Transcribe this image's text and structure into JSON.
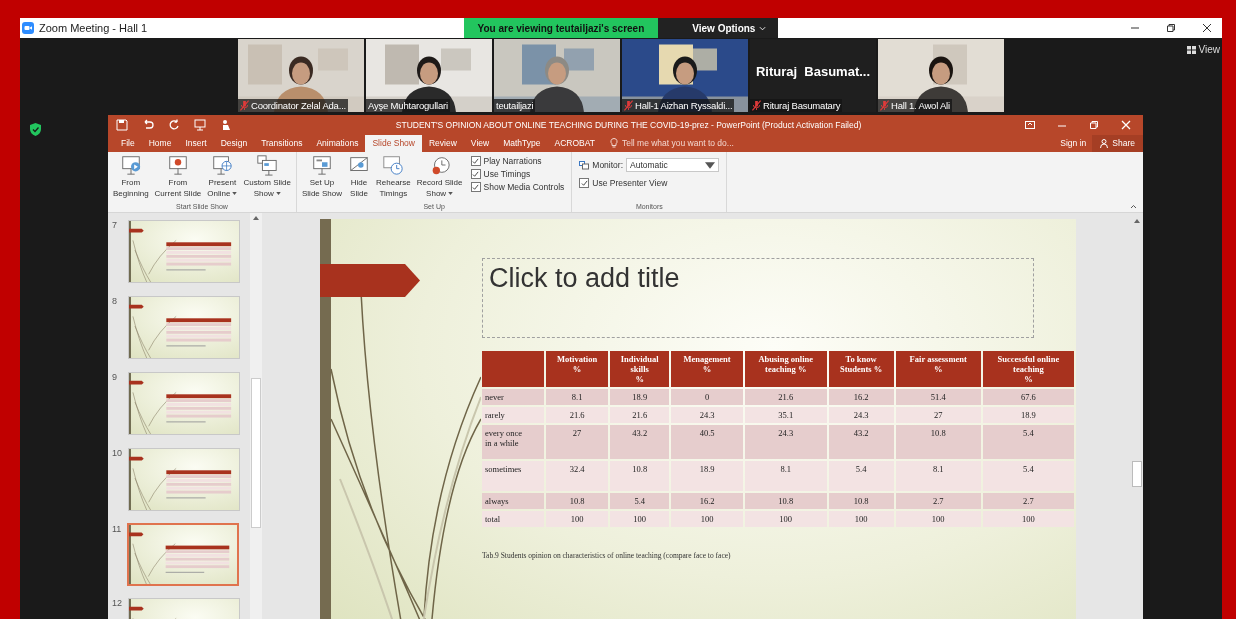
{
  "zoom": {
    "title": "Zoom Meeting - Hall 1",
    "banner": "You are viewing teutailjazi's screen",
    "view_options": "View Options",
    "view": "View"
  },
  "participants": [
    {
      "kind": "video",
      "name": "Coordinator Zelal Ada...",
      "muted": true
    },
    {
      "kind": "video",
      "name": "Ayşe Muhtarogullari",
      "muted": false
    },
    {
      "kind": "video",
      "name": "teutailjazi",
      "muted": false
    },
    {
      "kind": "video",
      "name": "Hall-1 Aizhan Ryssaldi...",
      "muted": true
    },
    {
      "kind": "avatar",
      "display_name": "Rituraj  Basumat...",
      "name": "Rituraj Basumatary",
      "muted": true
    },
    {
      "kind": "video",
      "name": "Hall 1. Awol Ali",
      "muted": true
    }
  ],
  "powerpoint": {
    "title": "STUDENT'S OPINION ABOUT ONLINE TEACHING DURING THE COVID-19-prez - PowerPoint (Product Activation Failed)",
    "tabs": [
      {
        "label": "File",
        "selected": false
      },
      {
        "label": "Home",
        "selected": false
      },
      {
        "label": "Insert",
        "selected": false
      },
      {
        "label": "Design",
        "selected": false
      },
      {
        "label": "Transitions",
        "selected": false
      },
      {
        "label": "Animations",
        "selected": false
      },
      {
        "label": "Slide Show",
        "selected": true
      },
      {
        "label": "Review",
        "selected": false
      },
      {
        "label": "View",
        "selected": false
      },
      {
        "label": "MathType",
        "selected": false
      },
      {
        "label": "ACROBAT",
        "selected": false
      }
    ],
    "tell_me": "Tell me what you want to do...",
    "sign_in": "Sign in",
    "share": "Share",
    "ribbon": [
      {
        "label": "Start Slide Show",
        "buttons": [
          {
            "lines": [
              "From",
              "Beginning"
            ],
            "menu": false
          },
          {
            "lines": [
              "From",
              "Current Slide"
            ],
            "menu": false
          },
          {
            "lines": [
              "Present",
              "Online"
            ],
            "menu": true
          },
          {
            "lines": [
              "Custom Slide",
              "Show"
            ],
            "menu": true
          }
        ]
      },
      {
        "label": "Set Up",
        "buttons": [
          {
            "lines": [
              "Set Up",
              "Slide Show"
            ],
            "menu": false
          },
          {
            "lines": [
              "Hide",
              "Slide"
            ],
            "menu": false
          },
          {
            "lines": [
              "Rehearse",
              "Timings"
            ],
            "menu": false
          },
          {
            "lines": [
              "Record Slide",
              "Show"
            ],
            "menu": true
          }
        ],
        "checkboxes": [
          {
            "label": "Play Narrations",
            "checked": true
          },
          {
            "label": "Use Timings",
            "checked": true
          },
          {
            "label": "Show Media Controls",
            "checked": true
          }
        ]
      },
      {
        "label": "Monitors",
        "monitor_label": "Monitor:",
        "monitor_value": "Automatic",
        "checkboxes": [
          {
            "label": "Use Presenter View",
            "checked": true
          }
        ]
      }
    ],
    "thumbnails": [
      {
        "number": "7",
        "selected": false
      },
      {
        "number": "8",
        "selected": false
      },
      {
        "number": "9",
        "selected": false
      },
      {
        "number": "10",
        "selected": false
      },
      {
        "number": "11",
        "selected": true
      },
      {
        "number": "12",
        "selected": false
      }
    ],
    "slide": {
      "title_placeholder": "Click to add title",
      "table": {
        "columns": [
          "Motivation\n%",
          "Individual\nskills\n%",
          "Menagement\n%",
          "Abusing online\nteaching %",
          "To know\nStudents %",
          "Fair assessment\n%",
          "Successful online\nteaching\n%"
        ],
        "rows": [
          {
            "label": "never",
            "values": [
              "8.1",
              "18.9",
              "0",
              "21.6",
              "16.2",
              "51.4",
              "67.6"
            ]
          },
          {
            "label": "rarely",
            "values": [
              "21.6",
              "21.6",
              "24.3",
              "35.1",
              "24.3",
              "27",
              "18.9"
            ]
          },
          {
            "label": "every once\nin a while",
            "values": [
              "27",
              "43.2",
              "40.5",
              "24.3",
              "43.2",
              "10.8",
              "5.4"
            ]
          },
          {
            "label": "sometimes",
            "values": [
              "32.4",
              "10.8",
              "18.9",
              "8.1",
              "5.4",
              "8.1",
              "5.4"
            ]
          },
          {
            "label": "always",
            "values": [
              "10.8",
              "5.4",
              "16.2",
              "10.8",
              "10.8",
              "2.7",
              "2.7"
            ]
          },
          {
            "label": "total",
            "values": [
              "100",
              "100",
              "100",
              "100",
              "100",
              "100",
              "100"
            ]
          }
        ]
      },
      "caption": "Tab.9 Students opinion on characteristics of online teaching (compare face to face)"
    }
  }
}
